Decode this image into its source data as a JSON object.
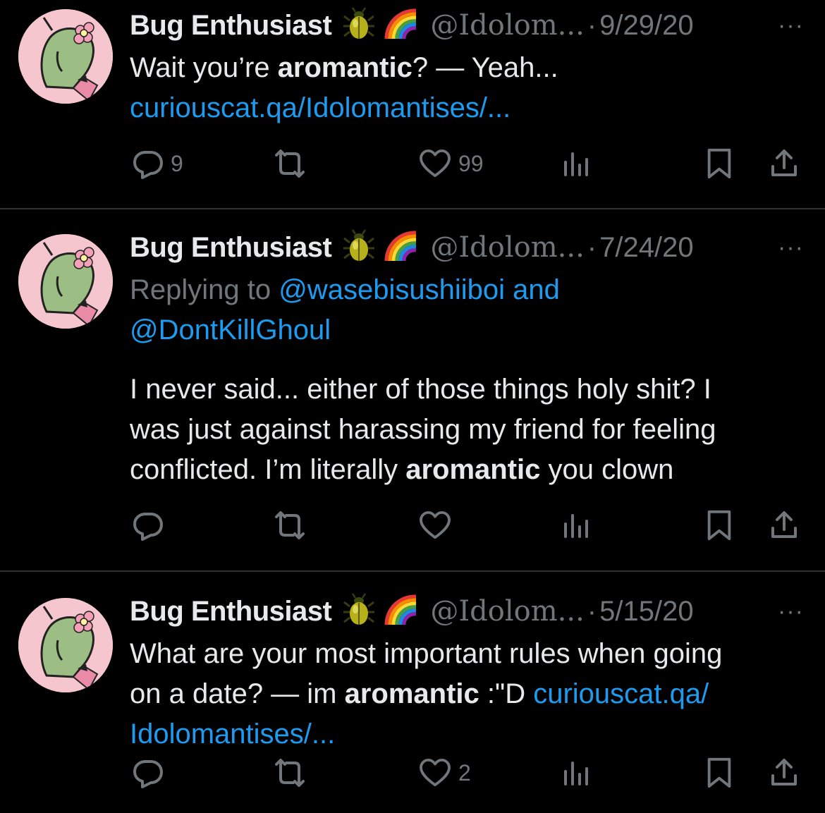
{
  "tweets": [
    {
      "name": "Bug Enthusiast",
      "handle": "@Idolom...",
      "sep": "·",
      "date": "9/29/20",
      "more": "···",
      "replying_prefix": "",
      "replying_to": "",
      "replying_to_2": "",
      "text_1": "Wait you’re ",
      "text_bold": "aromantic",
      "text_2": "? — Yeah...",
      "link_1": "curiouscat.qa/Idolomantises/...",
      "link_2": "",
      "counts": {
        "replies": "9",
        "retweets": "",
        "likes": "99"
      }
    },
    {
      "name": "Bug Enthusiast",
      "handle": "@Idolom...",
      "sep": "·",
      "date": "7/24/20",
      "more": "···",
      "replying_prefix": "Replying to ",
      "replying_to": "@wasebisushiiboi and",
      "replying_to_2": "@DontKillGhoul",
      "line_1": "I never said... either of those things holy shit? I",
      "line_2": "was just against harassing my friend for feeling",
      "line_3a": "conflicted. I’m literally ",
      "text_bold": "aromantic",
      "line_3b": " you clown",
      "counts": {
        "replies": "",
        "retweets": "",
        "likes": ""
      }
    },
    {
      "name": "Bug Enthusiast",
      "handle": "@Idolom...",
      "sep": "·",
      "date": "5/15/20",
      "more": "···",
      "line_1": "What are your most important rules when going",
      "line_2a": "on a date? — im ",
      "text_bold": "aromantic",
      "line_2b": " :\"D ",
      "link_1": "curiouscat.qa/",
      "link_2": "Idolomantises/...",
      "counts": {
        "replies": "",
        "retweets": "",
        "likes": "2"
      }
    }
  ],
  "icons": [
    "beetle-emoji",
    "rainbow-emoji",
    "reply-icon",
    "retweet-icon",
    "like-icon",
    "views-icon",
    "bookmark-icon",
    "share-icon"
  ],
  "colors": {
    "background": "#000000",
    "text": "#e7e9ea",
    "muted": "#71767b",
    "link": "#1d9bf0",
    "divider": "#2f3336"
  }
}
